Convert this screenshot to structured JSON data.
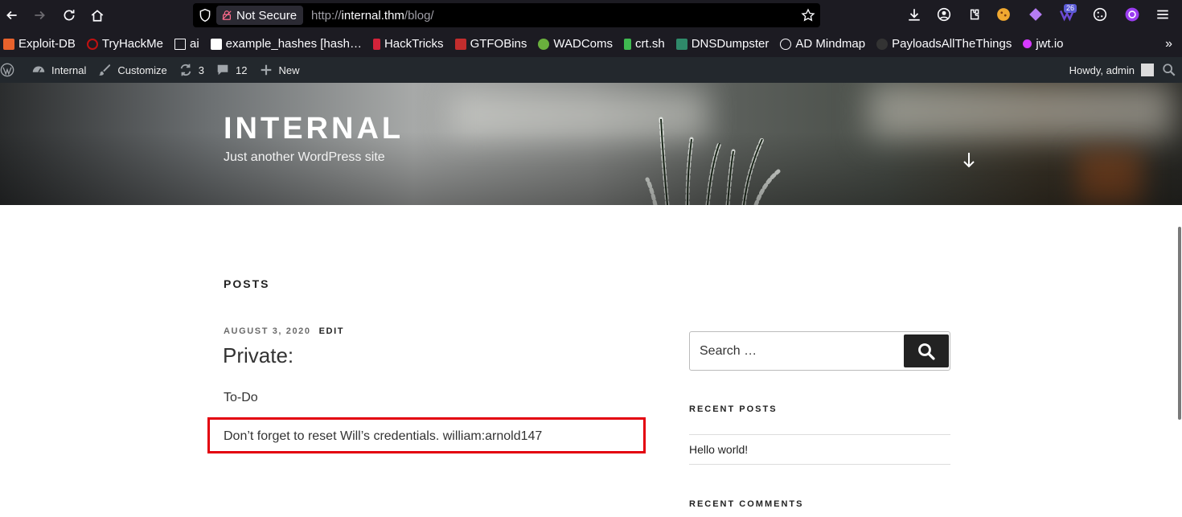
{
  "browser": {
    "not_secure_label": "Not Secure",
    "url_prefix": "http://",
    "url_host": "internal.thm",
    "url_path": "/blog/",
    "extension_badge": "26"
  },
  "bookmarks": [
    {
      "label": "Exploit-DB",
      "color": "#e8622c"
    },
    {
      "label": "TryHackMe",
      "color": "#c11111"
    },
    {
      "label": "ai",
      "color": "#fbfbfe"
    },
    {
      "label": "example_hashes [hash…",
      "color": "#ffffff"
    },
    {
      "label": "HackTricks",
      "color": "#d3233a"
    },
    {
      "label": "GTFOBins",
      "color": "#c22d2d"
    },
    {
      "label": "WADComs",
      "color": "#6aaf3d"
    },
    {
      "label": "crt.sh",
      "color": "#3fb950"
    },
    {
      "label": "DNSDumpster",
      "color": "#2f8a6a"
    },
    {
      "label": "AD Mindmap",
      "color": "#fbfbfe"
    },
    {
      "label": "PayloadsAllTheThings",
      "color": "#333333"
    },
    {
      "label": "jwt.io",
      "color": "#d63aff"
    }
  ],
  "adminbar": {
    "site_name": "Internal",
    "customize": "Customize",
    "updates": "3",
    "comments": "12",
    "new": "New",
    "howdy": "Howdy, admin"
  },
  "header": {
    "title": "INTERNAL",
    "description": "Just another WordPress site"
  },
  "main": {
    "posts_heading": "POSTS",
    "post": {
      "date": "AUGUST 3, 2020",
      "edit": "EDIT",
      "title": "Private:",
      "paragraph1": "To-Do",
      "paragraph2": "Don’t forget to reset Will’s credentials. william:arnold147"
    }
  },
  "sidebar": {
    "search_placeholder": "Search …",
    "recent_posts_title": "RECENT POSTS",
    "recent_posts": [
      "Hello world!"
    ],
    "recent_comments_title": "RECENT COMMENTS"
  },
  "colors": {
    "highlight": "#e3000f",
    "adminbar": "#23282d",
    "chrome": "#1c1b22"
  }
}
